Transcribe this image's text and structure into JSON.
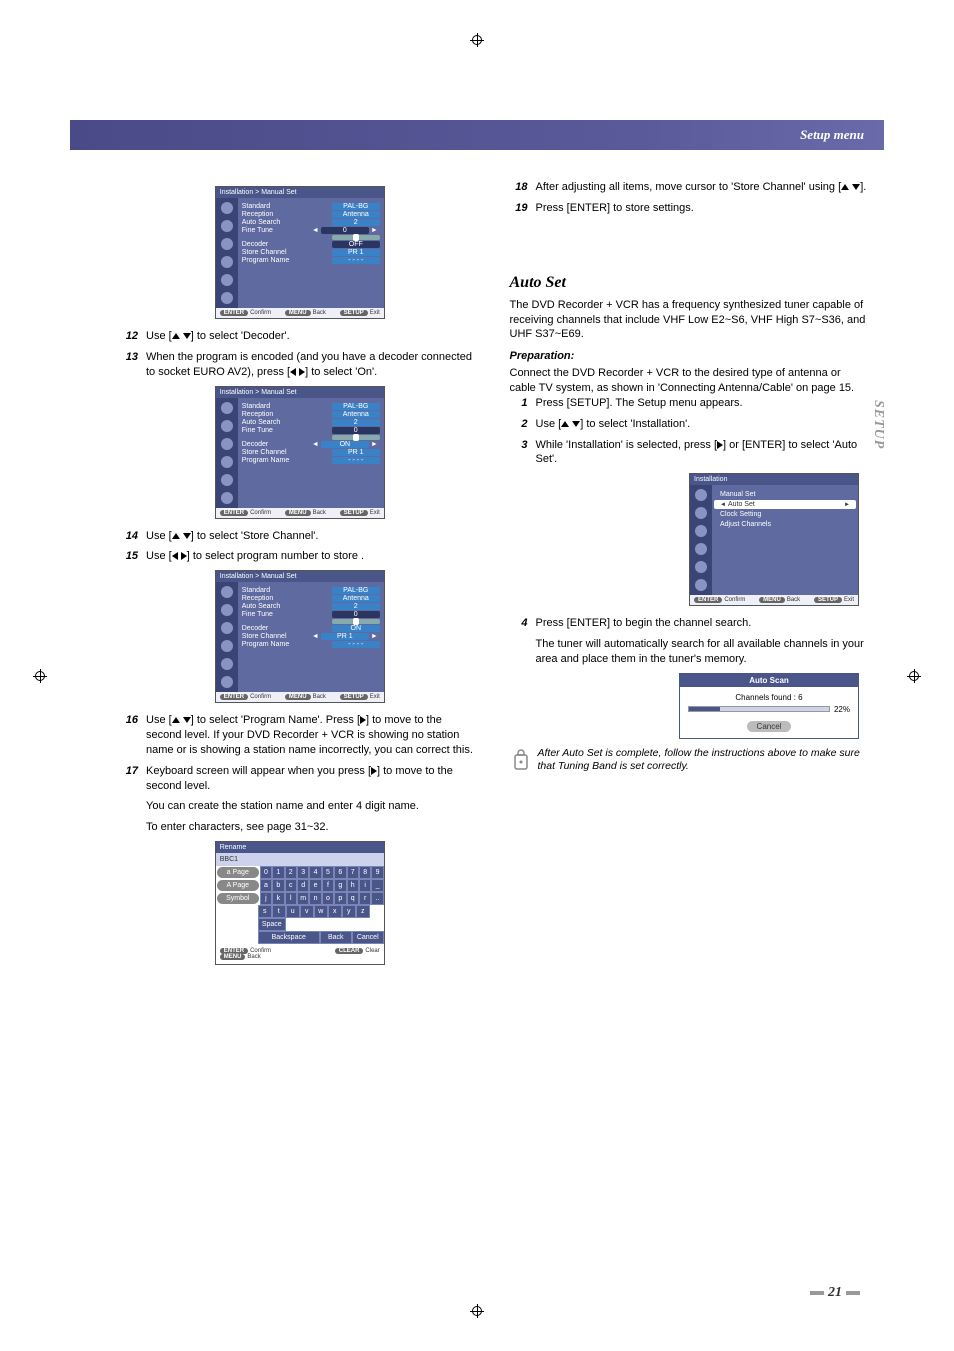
{
  "header": {
    "title": "Setup menu"
  },
  "side_tab": "SETUP",
  "page_number": "21",
  "left": {
    "step12": "Use [… …] to select 'Decoder'.",
    "step13": "When the program is encoded (and you have a decoder connected to socket EURO AV2), press [… …] to select 'On'.",
    "step14": "Use [… …] to select 'Store Channel'.",
    "step15": "Use [… …] to select program number to store .",
    "step16": "Use [… …] to select 'Program Name'. Press […] to move to the second level. If your DVD Recorder + VCR is showing no station name or is showing a station name incorrectly, you can correct this.",
    "step17": "Keyboard screen will appear when you press […] to move to the second level.",
    "step17_sub1": "You can create the station name and enter 4 digit name.",
    "step17_sub2": "To enter characters, see page 31~32."
  },
  "right": {
    "step18": "After adjusting all items, move cursor to 'Store Channel' using [… …].",
    "step19": "Press [ENTER] to store settings.",
    "autoset_title": "Auto Set",
    "autoset_intro": "The DVD Recorder + VCR has a frequency synthesized tuner capable of receiving channels that include VHF Low E2~S6, VHF High S7~S36, and UHF S37~E69.",
    "prep_title": "Preparation:",
    "prep_text": "Connect the DVD Recorder + VCR to the desired type of antenna or cable TV system, as shown in 'Connecting Antenna/Cable' on page 15.",
    "a1": "Press [SETUP]. The Setup menu appears.",
    "a2": "Use [… …] to select 'Installation'.",
    "a3": "While 'Installation' is selected, press […] or [ENTER] to select 'Auto Set'.",
    "a4": "Press [ENTER] to begin the channel search.",
    "a4_sub": "The tuner will automatically search for all available channels in your area and place them in the tuner's memory.",
    "note": "After Auto Set is complete, follow the instructions above to make sure that Tuning Band is set correctly."
  },
  "osd": {
    "breadcrumb": "Installation  > Manual Set",
    "standard_l": "Standard",
    "standard_v": "PAL-BG",
    "reception_l": "Reception",
    "reception_v": "Antenna",
    "autosearch_l": "Auto Search",
    "autosearch_v": "2",
    "finetune_l": "Fine Tune",
    "finetune_v": "0",
    "decoder_l": "Decoder",
    "decoder_off": "OFF",
    "decoder_on": "ON",
    "store_l": "Store Channel",
    "store_v": "PR 1",
    "pname_l": "Program Name",
    "pname_v": "- - - -",
    "foot_confirm": "Confirm",
    "foot_back": "Back",
    "foot_exit": "Exit",
    "foot_enter": "ENTER",
    "foot_menu": "MENU",
    "foot_setup": "SETUP"
  },
  "inst_menu": {
    "title": "Installation",
    "items": [
      "Manual Set",
      "Auto Set",
      "Clock Setting",
      "Adjust Channels"
    ],
    "selected": "Auto Set"
  },
  "autoscan": {
    "title": "Auto Scan",
    "line": "Channels found : 6",
    "percent": "22%",
    "cancel": "Cancel"
  },
  "rename": {
    "title": "Rename",
    "field": "BBC1",
    "left_btn1": "a Page",
    "left_btn2": "A Page",
    "left_btn3": "Symbol",
    "row1": [
      "0",
      "1",
      "2",
      "3",
      "4",
      "5",
      "6",
      "7",
      "8",
      "9"
    ],
    "row2": [
      "a",
      "b",
      "c",
      "d",
      "e",
      "f",
      "g",
      "h",
      "i",
      "_"
    ],
    "row3": [
      "j",
      "k",
      "l",
      "m",
      "n",
      "o",
      "p",
      "q",
      "r",
      ".."
    ],
    "row4": [
      "s",
      "t",
      "u",
      "v",
      "w",
      "x",
      "y",
      "z",
      "Space"
    ],
    "bot": [
      "Backspace",
      "Back",
      "Cancel"
    ],
    "foot_confirm": "Confirm",
    "foot_back": "Back",
    "foot_clear": "Clear",
    "foot_enter": "ENTER",
    "foot_menu": "MENU",
    "foot_cbtn": "CLEAR"
  }
}
